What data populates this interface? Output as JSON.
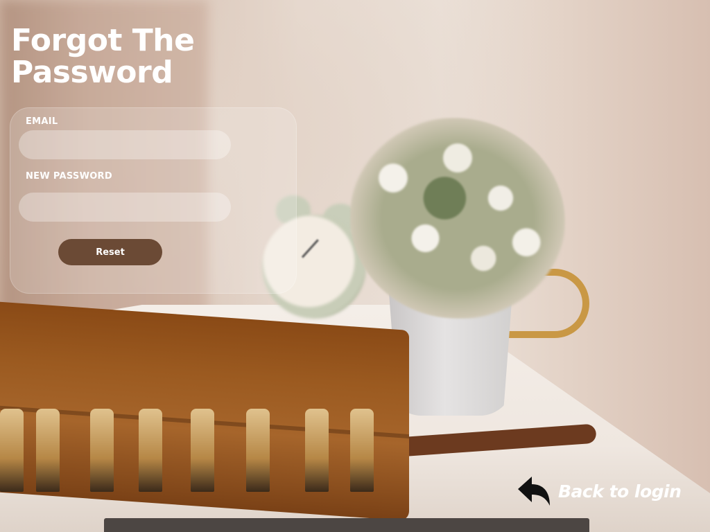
{
  "page": {
    "title": "Forgot The Password"
  },
  "form": {
    "email_label": "EMAIL",
    "email_value": "",
    "email_placeholder": "",
    "new_password_label": "NEW PASSWORD",
    "new_password_value": "",
    "new_password_placeholder": "",
    "reset_label": "Reset"
  },
  "navigation": {
    "back_label": "Back to login",
    "back_icon": "back-arrow-icon"
  },
  "colors": {
    "accent_button": "#6b4a35",
    "text_light": "#ffffff",
    "card_background": "rgba(255,255,255,0.18)"
  }
}
